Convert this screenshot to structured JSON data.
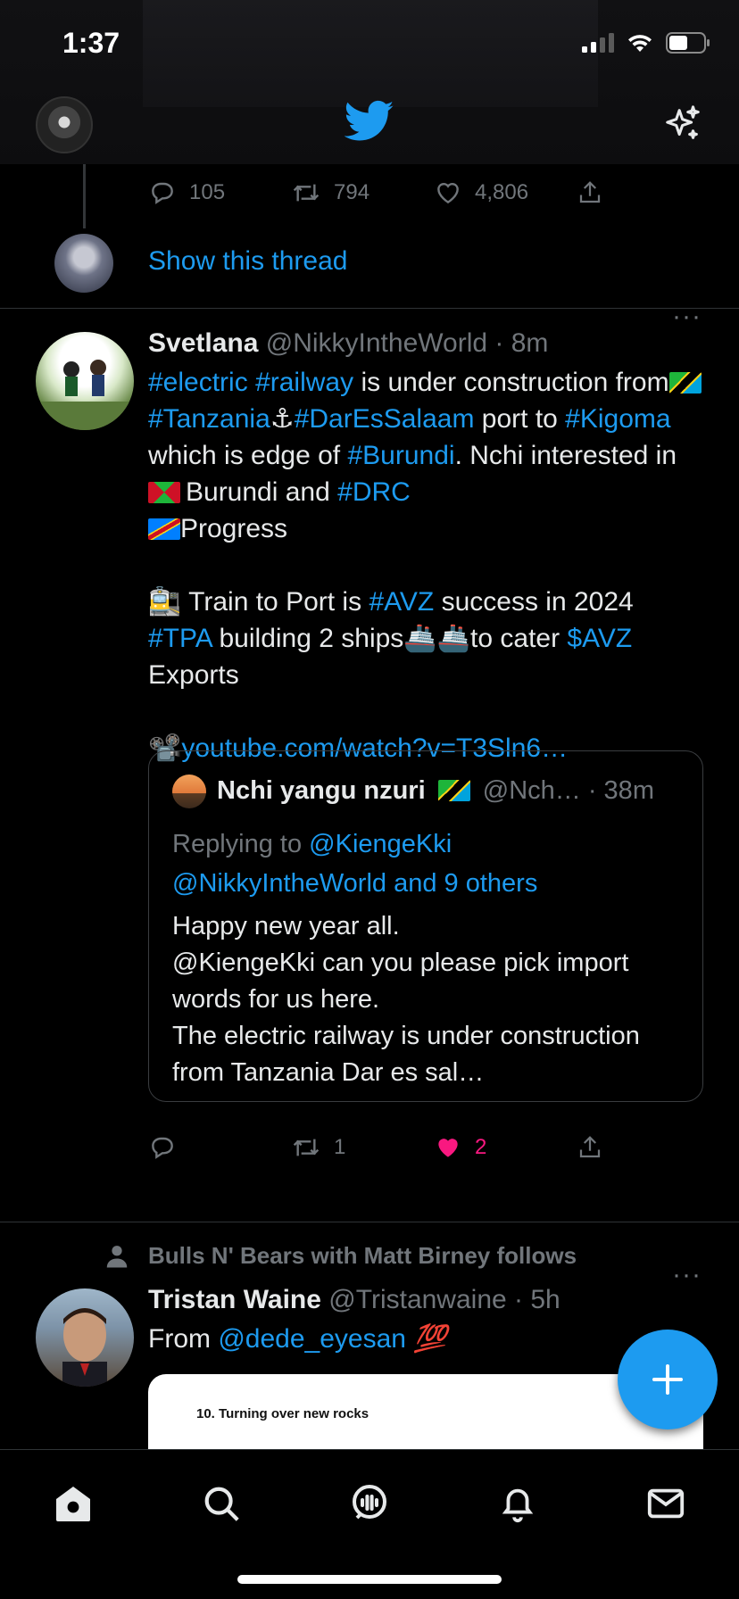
{
  "status": {
    "time": "1:37"
  },
  "previous_tweet": {
    "replies": "105",
    "retweets": "794",
    "likes": "4,806",
    "show_thread": "Show this thread"
  },
  "tweet1": {
    "name": "Svetlana",
    "handle": "@NikkyIntheWorld",
    "time": "· 8m",
    "more": "···",
    "p1": [
      "#electric",
      " ",
      "#railway",
      " is under construction from",
      " ",
      "#Tanzania",
      "⚓",
      "#DarEsSalaam",
      " port to ",
      "#Kigoma",
      " which is edge of ",
      "#Burundi",
      ". Nchi interested in ",
      "Burundi and ",
      "#DRC",
      "Progress"
    ],
    "p2": [
      "🚉 Train to Port is ",
      "#AVZ",
      " success in 2024 ",
      "#TPA",
      " building 2 ships",
      "🚢🚢",
      "to cater ",
      "$AVZ",
      " Exports"
    ],
    "p3": [
      "📽️",
      "youtube.com/watch?v=T3Sln6…"
    ],
    "quote": {
      "name": "Nchi yangu nzuri",
      "handle": "@Nch…",
      "time": "· 38m",
      "reply_prefix": "Replying to ",
      "reply_user1": "@KiengeKki",
      "reply_user2": "@NikkyIntheWorld and 9 others",
      "text_lines": [
        "Happy new year all.",
        "@KiengeKki can you please pick import words for us here.",
        "The electric railway is under construction from Tanzania Dar es sal…"
      ]
    },
    "retweets": "1",
    "likes": "2"
  },
  "follow_context": "Bulls N' Bears with Matt Birney follows",
  "tweet2": {
    "name": "Tristan Waine",
    "handle": "@Tristanwaine",
    "time": "· 5h",
    "more": "···",
    "text_prefix": "From ",
    "mention": "@dede_eyesan",
    "emoji": "💯",
    "card_title": "10.  Turning over new rocks"
  },
  "colors": {
    "accent": "#1d9bf0",
    "like": "#f91880",
    "muted": "#71767b",
    "bg": "#000000"
  }
}
